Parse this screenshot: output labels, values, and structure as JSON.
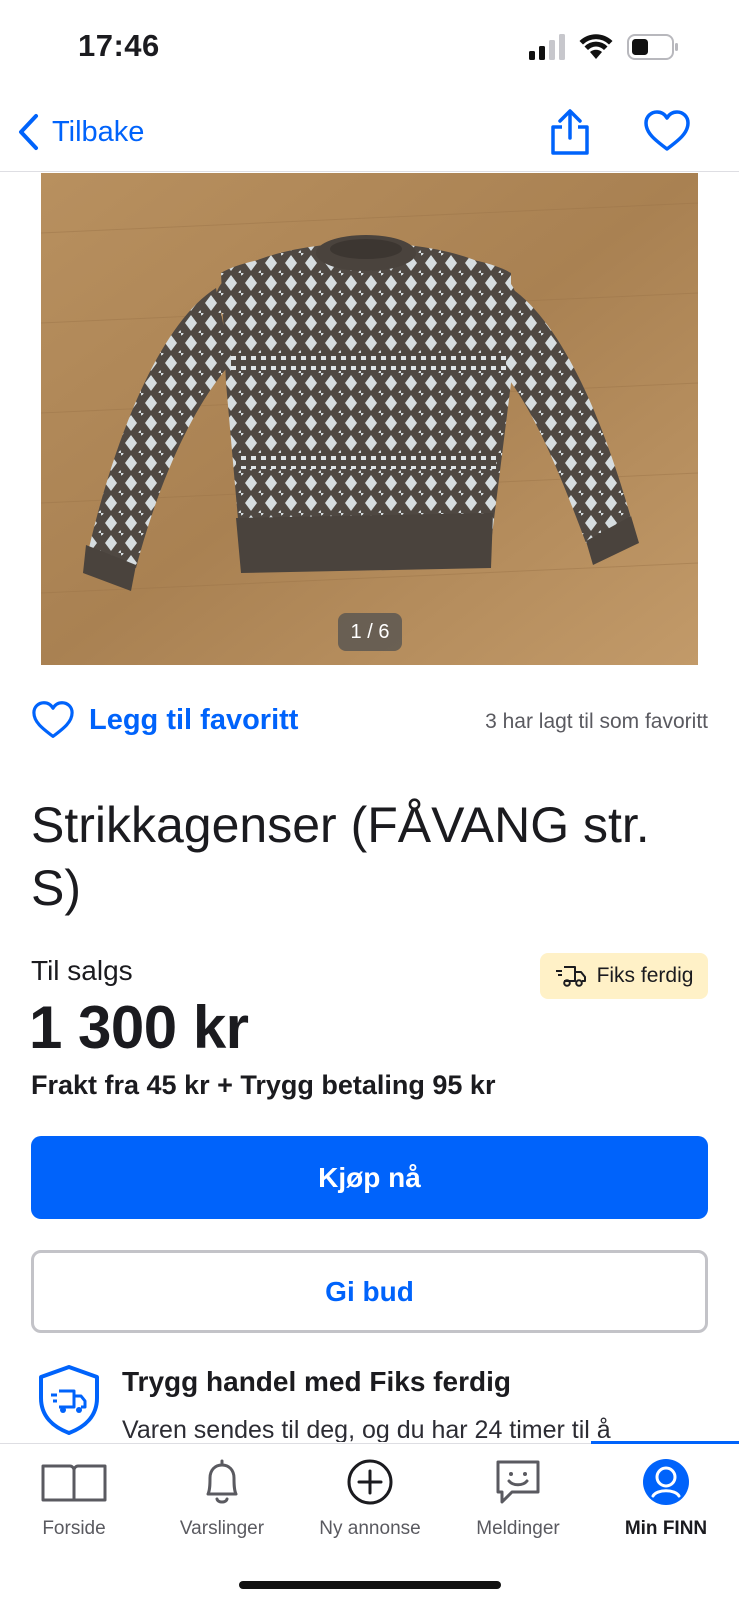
{
  "status_bar": {
    "time": "17:46"
  },
  "nav": {
    "back_label": "Tilbake"
  },
  "listing": {
    "image_counter": "1 / 6",
    "favorite_label": "Legg til favoritt",
    "favorite_count_text": "3 har lagt til som favoritt",
    "title": "Strikkagenser (FÅVANG str. S)",
    "sale_status": "Til salgs",
    "badge_label": "Fiks ferdig",
    "price": "1 300 kr",
    "shipping_text": "Frakt fra 45 kr + Trygg betaling 95 kr",
    "buy_label": "Kjøp nå",
    "bid_label": "Gi bud",
    "safe_title": "Trygg handel med Fiks ferdig",
    "safe_text": "Varen sendes til deg, og du har 24 timer til å"
  },
  "tabs": [
    {
      "label": "Forside",
      "icon": "book-icon"
    },
    {
      "label": "Varslinger",
      "icon": "bell-icon"
    },
    {
      "label": "Ny annonse",
      "icon": "plus-circle-icon"
    },
    {
      "label": "Meldinger",
      "icon": "chat-icon"
    },
    {
      "label": "Min FINN",
      "icon": "profile-icon",
      "active": true
    }
  ],
  "colors": {
    "accent": "#0063fb",
    "badge_bg": "#fff1c7",
    "text": "#1b1b1f"
  }
}
